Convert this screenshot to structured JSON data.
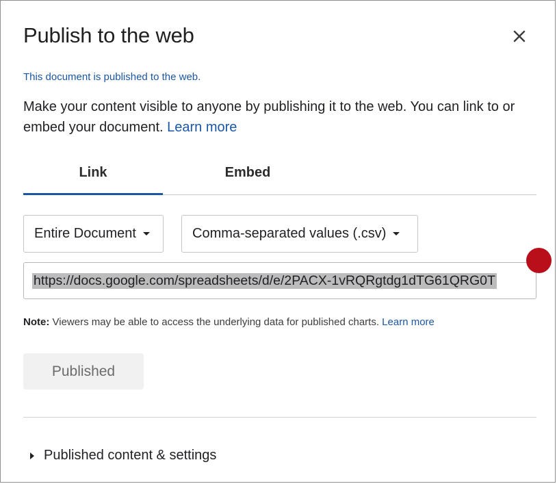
{
  "dialog": {
    "title": "Publish to the web",
    "status": "This document is published to the web.",
    "description": "Make your content visible to anyone by publishing it to the web. You can link to or embed your document.",
    "learn_more": "Learn more"
  },
  "tabs": [
    {
      "label": "Link",
      "active": true
    },
    {
      "label": "Embed",
      "active": false
    }
  ],
  "selects": {
    "scope": "Entire Document",
    "format": "Comma-separated values (.csv)"
  },
  "url": {
    "value": "https://docs.google.com/spreadsheets/d/e/2PACX-1vRQRgtdg1dTG61QRG0T"
  },
  "note": {
    "label": "Note:",
    "text": "Viewers may be able to access the underlying data for published charts.",
    "learn_more": "Learn more"
  },
  "actions": {
    "published_label": "Published"
  },
  "expander": {
    "label": "Published content & settings"
  },
  "icons": {
    "close": "close-icon",
    "caret": "caret-down-icon",
    "expand": "triangle-right-icon"
  },
  "colors": {
    "accent": "#1a56a5",
    "marker": "#b80f1a",
    "selection": "#bcbcbc"
  }
}
